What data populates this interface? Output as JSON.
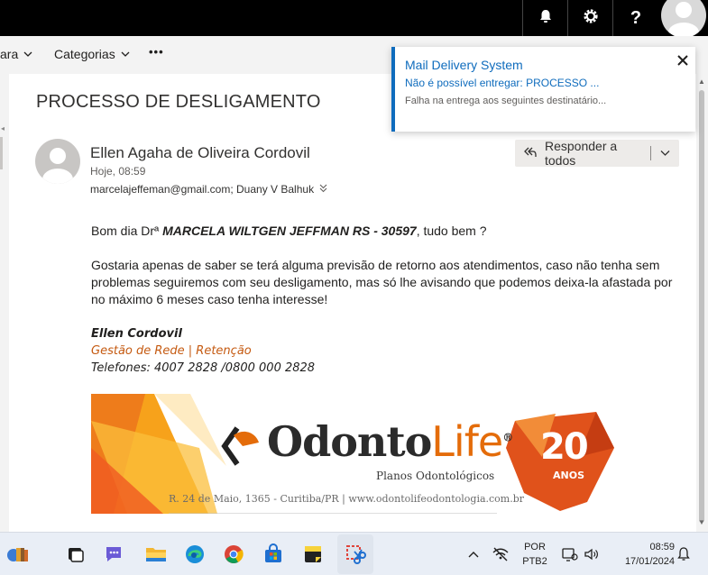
{
  "header": {
    "icons": [
      "bell-icon",
      "gear-icon",
      "help-icon"
    ],
    "help_label": "?"
  },
  "commandbar": {
    "partial_item": "ara",
    "categories_label": "Categorias",
    "more_label": "•••"
  },
  "message": {
    "subject": "PROCESSO DE DESLIGAMENTO",
    "sender_name": "Ellen Agaha de Oliveira Cordovil",
    "date": "Hoje, 08:59",
    "recipients": "marcelajeffeman@gmail.com; Duany V Balhuk",
    "reply_all_label": "Responder a todos",
    "greeting_pre": "Bom dia Drª ",
    "greeting_name": "MARCELA WILTGEN JEFFMAN RS - 30597",
    "greeting_post": ", tudo bem ?",
    "paragraph": "Gostaria apenas de saber se terá alguma previsão de retorno aos atendimentos, caso não tenha sem problemas seguiremos com seu desligamento, mas só lhe avisando que podemos deixa-la afastada por no máximo 6 meses caso tenha interesse!",
    "signature": {
      "name": "Ellen Cordovil",
      "role": "Gestão de Rede | Retenção",
      "phones": "Telefones: 4007 2828 /0800 000 2828"
    },
    "banner": {
      "brand_odonto": "Odonto",
      "brand_life": "Life",
      "registered": "®",
      "subtitle": "Planos Odontológicos",
      "address": "R. 24 de Maio, 1365 - Curitiba/PR  |  www.odontolifeodontologia.com.br",
      "anniversary_number": "20",
      "anniversary_word": "ANOS"
    }
  },
  "notification": {
    "title": "Mail Delivery System",
    "subject": "Não é possível entregar: PROCESSO ...",
    "preview": "Falha na entrega aos seguintes destinatário..."
  },
  "taskbar": {
    "language": "POR",
    "layout": "PTB2",
    "time": "08:59",
    "date": "17/01/2024"
  },
  "colors": {
    "accent": "#0f6cbd",
    "signature_role": "#c55a11",
    "brand_orange": "#e46c0a"
  }
}
